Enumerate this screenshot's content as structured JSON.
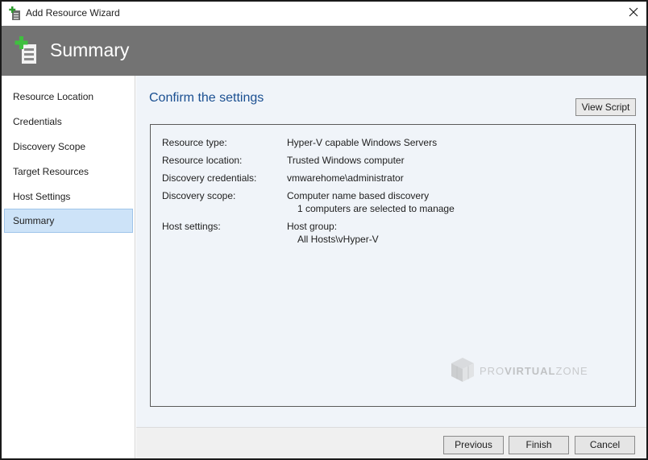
{
  "window": {
    "title": "Add Resource Wizard",
    "close_icon": "close-icon"
  },
  "banner": {
    "title": "Summary",
    "icon": "server-add-icon"
  },
  "sidebar": {
    "items": [
      {
        "label": "Resource Location",
        "selected": false
      },
      {
        "label": "Credentials",
        "selected": false
      },
      {
        "label": "Discovery Scope",
        "selected": false
      },
      {
        "label": "Target Resources",
        "selected": false
      },
      {
        "label": "Host Settings",
        "selected": false
      },
      {
        "label": "Summary",
        "selected": true
      }
    ]
  },
  "main": {
    "heading": "Confirm the settings",
    "view_script_label": "View Script",
    "settings": [
      {
        "label": "Resource type:",
        "value": "Hyper-V capable Windows Servers"
      },
      {
        "label": "Resource location:",
        "value": "Trusted Windows computer"
      },
      {
        "label": "Discovery credentials:",
        "value": "vmwarehome\\administrator"
      },
      {
        "label": "Discovery scope:",
        "value": "Computer name based discovery",
        "sub": "1 computers are selected to manage"
      },
      {
        "label": "Host settings:",
        "value": "Host group:",
        "sub": "All Hosts\\vHyper-V"
      }
    ],
    "watermark": {
      "prefix": "PRO",
      "middle": "VIRTUAL",
      "suffix": "ZONE"
    }
  },
  "footer": {
    "previous_label": "Previous",
    "finish_label": "Finish",
    "cancel_label": "Cancel"
  },
  "colors": {
    "banner_bg": "#737373",
    "heading": "#1a4f91",
    "selected_bg": "#cde3f8",
    "selected_border": "#9fc4ea",
    "content_bg": "#f0f4f9"
  }
}
